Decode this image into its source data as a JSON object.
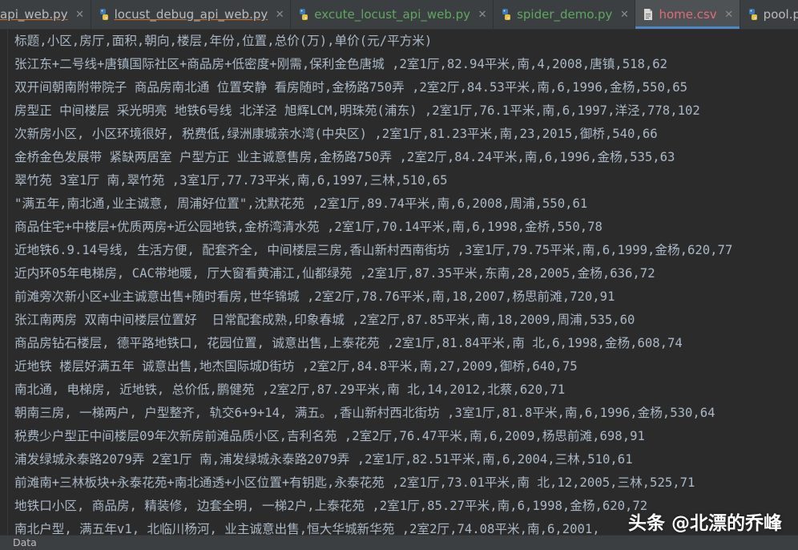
{
  "tabs": [
    {
      "label": "api_web.py",
      "icon": "python-file-icon",
      "style": "ul",
      "active": false
    },
    {
      "label": "locust_debug_api_web.py",
      "icon": "python-file-icon",
      "style": "ul",
      "active": false
    },
    {
      "label": "excute_locust_api_web.py",
      "icon": "python-file-icon",
      "style": "modified",
      "active": false
    },
    {
      "label": "spider_demo.py",
      "icon": "python-file-icon",
      "style": "modified",
      "active": false
    },
    {
      "label": "home.csv",
      "icon": "text-file-icon",
      "style": "csv",
      "active": true
    },
    {
      "label": "pool.py",
      "icon": "python-file-icon",
      "style": "normal",
      "active": false
    }
  ],
  "editor": {
    "lines": [
      "标题,小区,房厅,面积,朝向,楼层,年份,位置,总价(万),单价(元/平方米)",
      "张江东+二号线+唐镇国际社区+商品房+低密度+刚需,保利金色唐城 ,2室1厅,82.94平米,南,4,2008,唐镇,518,62",
      "双开间朝南附带院子 商品房南北通 位置安静 看房随时,金杨路750弄 ,2室2厅,84.53平米,南,6,1996,金杨,550,65",
      "房型正 中间楼层 采光明亮 地铁6号线 北洋泾 旭辉LCM,明珠苑(浦东) ,2室1厅,76.1平米,南,6,1997,洋泾,778,102",
      "次新房小区, 小区环境很好, 税费低,绿洲康城亲水湾(中央区) ,2室1厅,81.23平米,南,23,2015,御桥,540,66",
      "金桥金色发展带 紧缺两居室 户型方正 业主诚意售房,金杨路750弄 ,2室2厅,84.24平米,南,6,1996,金杨,535,63",
      "翠竹苑 3室1厅 南,翠竹苑 ,3室1厅,77.73平米,南,6,1997,三林,510,65",
      "\"满五年,南北通,业主诚意, 周浦好位置\",沈默花苑 ,2室1厅,89.74平米,南,6,2008,周浦,550,61",
      "商品住宅+中楼层+优质两房+近公园地铁,金桥湾清水苑 ,2室1厅,70.14平米,南,6,1998,金桥,550,78",
      "近地铁6.9.14号线, 生活方便, 配套齐全, 中间楼层三房,香山新村西南街坊 ,3室1厅,79.75平米,南,6,1999,金杨,620,77",
      "近内环05年电梯房, CAC带地暖, 厅大窗看黄浦江,仙都绿苑 ,2室1厅,87.35平米,东南,28,2005,金杨,636,72",
      "前滩旁次新小区+业主诚意出售+随时看房,世华锦城 ,2室2厅,78.76平米,南,18,2007,杨思前滩,720,91",
      "张江南两房 双南中间楼层位置好  日常配套成熟,印象春城 ,2室2厅,87.85平米,南,18,2009,周浦,535,60",
      "商品房钻石楼层, 德平路地铁口, 花园位置, 诚意出售,上泰花苑 ,2室1厅,81.84平米,南 北,6,1998,金杨,608,74",
      "近地铁 楼层好满五年 诚意出售,地杰国际城D街坊 ,2室2厅,84.8平米,南,27,2009,御桥,640,75",
      "南北通, 电梯房, 近地铁, 总价低,鹏健苑 ,2室2厅,87.29平米,南 北,14,2012,北蔡,620,71",
      "朝南三房, 一梯两户, 户型整齐, 轨交6+9+14, 满五。,香山新村西北街坊 ,3室1厅,81.8平米,南,6,1996,金杨,530,64",
      "税费少户型正中间楼层09年次新房前滩品质小区,吉利名苑 ,2室2厅,76.47平米,南,6,2009,杨思前滩,698,91",
      "浦发绿城永泰路2079弄 2室1厅 南,浦发绿城永泰路2079弄 ,2室1厅,82.51平米,南,6,2004,三林,510,61",
      "前滩南+三林板块+永泰花苑+南北通透+小区位置+有钥匙,永泰花苑 ,2室1厅,73.01平米,南 北,12,2005,三林,525,71",
      "地铁口小区, 商品房, 精装修, 边套全明, 一梯2户,上泰花苑 ,2室1厅,85.27平米,南,6,1998,金杨,620,72",
      "南北户型, 满五年v1, 北临川杨河, 业主诚意出售,恒大华城新华苑 ,2室2厅,74.08平米,南,6,2001,"
    ]
  },
  "status_bar": {
    "label": "Data"
  },
  "watermark": {
    "text": "头条 @北漂的乔峰"
  }
}
